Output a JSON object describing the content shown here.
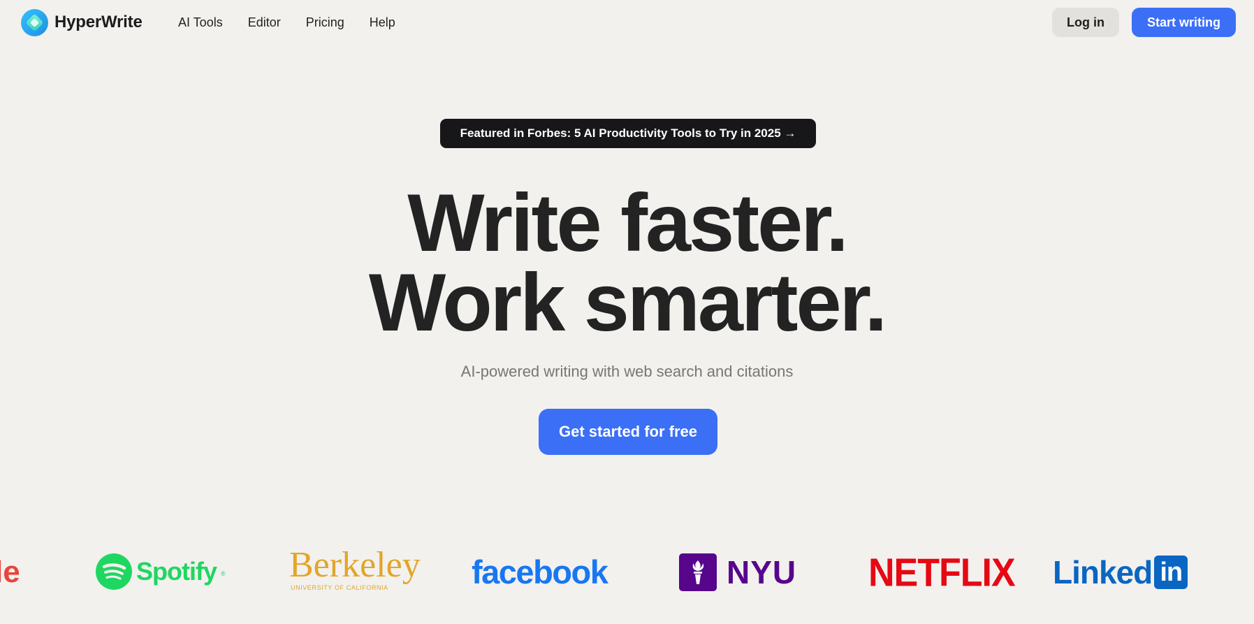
{
  "nav": {
    "brand": "HyperWrite",
    "links": [
      "AI Tools",
      "Editor",
      "Pricing",
      "Help"
    ],
    "login_label": "Log in",
    "start_label": "Start writing"
  },
  "hero": {
    "badge": "Featured in Forbes: 5 AI Productivity Tools to Try in 2025 →",
    "headline_line1": "Write faster.",
    "headline_line2": "Work smarter.",
    "subtitle": "AI-powered writing with web search and citations",
    "cta_label": "Get started for free"
  },
  "logos": {
    "partial": "le",
    "spotify": "Spotify",
    "spotify_mark": "®",
    "berkeley": "Berkeley",
    "berkeley_sub": "UNIVERSITY OF CALIFORNIA",
    "facebook": "facebook",
    "nyu": "NYU",
    "netflix": "NETFLIX",
    "linkedin_text": "Linked",
    "linkedin_box": "in"
  },
  "colors": {
    "background": "#f2f1ee",
    "accent": "#3b6ff6",
    "badge_bg": "#17171a",
    "spotify": "#1ed760",
    "berkeley": "#e2a52a",
    "facebook": "#1877f2",
    "nyu": "#57068c",
    "netflix": "#e50914",
    "linkedin": "#0a66c2"
  }
}
